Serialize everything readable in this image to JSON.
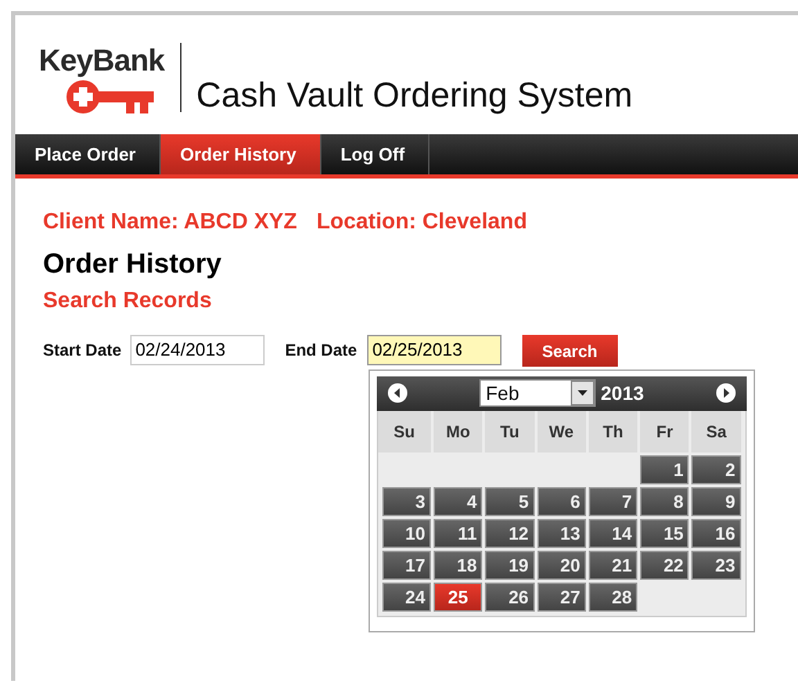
{
  "header": {
    "brand": "KeyBank",
    "title": "Cash Vault Ordering System"
  },
  "nav": [
    {
      "label": "Place Order",
      "selected": false
    },
    {
      "label": "Order History",
      "selected": true
    },
    {
      "label": "Log Off",
      "selected": false
    }
  ],
  "client": {
    "name_label": "Client Name: ABCD XYZ",
    "location_label": "Location: Cleveland"
  },
  "heading": "Order History",
  "subheading": "Search Records",
  "form": {
    "start_label": "Start Date",
    "start_value": "02/24/2013",
    "end_label": "End Date",
    "end_value": "02/25/2013",
    "end_focused": true,
    "button": "Search"
  },
  "datepicker": {
    "month": "Feb",
    "year": "2013",
    "weekdays": [
      "Su",
      "Mo",
      "Tu",
      "We",
      "Th",
      "Fr",
      "Sa"
    ],
    "weeks": [
      [
        {
          "label": "1",
          "selected": false
        },
        {
          "label": "2",
          "selected": false
        }
      ],
      [
        {
          "label": "3",
          "selected": false
        },
        {
          "label": "4",
          "selected": false
        },
        {
          "label": "5",
          "selected": false
        },
        {
          "label": "6",
          "selected": false
        },
        {
          "label": "7",
          "selected": false
        },
        {
          "label": "8",
          "selected": false
        },
        {
          "label": "9",
          "selected": false
        }
      ],
      [
        {
          "label": "10",
          "selected": false
        },
        {
          "label": "11",
          "selected": false
        },
        {
          "label": "12",
          "selected": false
        },
        {
          "label": "13",
          "selected": false
        },
        {
          "label": "14",
          "selected": false
        },
        {
          "label": "15",
          "selected": false
        },
        {
          "label": "16",
          "selected": false
        }
      ],
      [
        {
          "label": "17",
          "selected": false
        },
        {
          "label": "18",
          "selected": false
        },
        {
          "label": "19",
          "selected": false
        },
        {
          "label": "20",
          "selected": false
        },
        {
          "label": "21",
          "selected": false
        },
        {
          "label": "22",
          "selected": false
        },
        {
          "label": "23",
          "selected": false
        }
      ],
      [
        {
          "label": "24",
          "selected": false
        },
        {
          "label": "25",
          "selected": true
        },
        {
          "label": "26",
          "selected": false
        },
        {
          "label": "27",
          "selected": false
        },
        {
          "label": "28",
          "selected": false
        }
      ]
    ]
  }
}
